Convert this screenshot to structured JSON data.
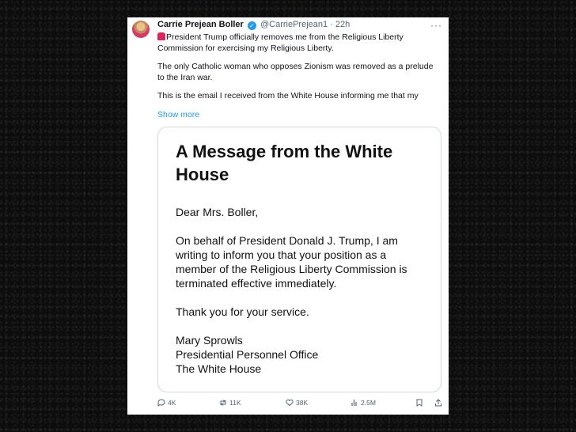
{
  "tweet": {
    "name": "Carrie Prejean Boller",
    "handle": "@CarriePrejean1",
    "dot": "·",
    "time": "22h",
    "more": "···",
    "paragraph1": "President Trump officially removes me from the Religious Liberty Commission for exercising my Religious Liberty.",
    "paragraph2": "The only Catholic woman who opposes Zionism was removed as a prelude to the Iran war.",
    "paragraph3": "This is the email I received from the White House informing me that my",
    "show_more": "Show more",
    "verified_icon": "check"
  },
  "card": {
    "title": "A Message from the White House",
    "greeting": "Dear Mrs. Boller,",
    "body": "On behalf of President Donald J. Trump, I am writing to inform you that your position as a member of the Religious Liberty Commission is terminated effective immediately.",
    "thanks": "Thank you for your service.",
    "signature_name": "Mary Sprowls",
    "signature_office": "Presidential Personnel Office",
    "signature_org": "The White House"
  },
  "actions": {
    "replies": "4K",
    "reposts": "11K",
    "likes": "38K",
    "views": "2.5M"
  }
}
